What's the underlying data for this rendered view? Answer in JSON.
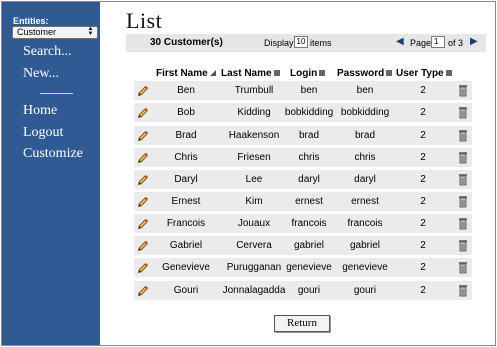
{
  "sidebar": {
    "entities_label": "Entities:",
    "entity_selected": "Customer",
    "links": [
      "Search...",
      "New...",
      "Home",
      "Logout",
      "Customize"
    ]
  },
  "page": {
    "title": "List"
  },
  "infobar": {
    "count_text": "30 Customer(s)",
    "display_label": "Display",
    "display_value": "10",
    "items_label": "items",
    "page_label": "Page",
    "page_value": "1",
    "of_label": "of 3"
  },
  "table": {
    "headers": {
      "first": "First Name",
      "last": "Last Name",
      "login": "Login",
      "password": "Password",
      "type": "User Type"
    },
    "rows": [
      {
        "first": "Ben",
        "last": "Trumbull",
        "login": "ben",
        "password": "ben",
        "type": "2"
      },
      {
        "first": "Bob",
        "last": "Kidding",
        "login": "bobkidding",
        "password": "bobkidding",
        "type": "2"
      },
      {
        "first": "Brad",
        "last": "Haakenson",
        "login": "brad",
        "password": "brad",
        "type": "2"
      },
      {
        "first": "Chris",
        "last": "Friesen",
        "login": "chris",
        "password": "chris",
        "type": "2"
      },
      {
        "first": "Daryl",
        "last": "Lee",
        "login": "daryl",
        "password": "daryl",
        "type": "2"
      },
      {
        "first": "Ernest",
        "last": "Kim",
        "login": "ernest",
        "password": "ernest",
        "type": "2"
      },
      {
        "first": "Francois",
        "last": "Jouaux",
        "login": "francois",
        "password": "francois",
        "type": "2"
      },
      {
        "first": "Gabriel",
        "last": "Cervera",
        "login": "gabriel",
        "password": "gabriel",
        "type": "2"
      },
      {
        "first": "Genevieve",
        "last": "Purugganan",
        "login": "genevieve",
        "password": "genevieve",
        "type": "2"
      },
      {
        "first": "Gouri",
        "last": "Jonnalagadda",
        "login": "gouri",
        "password": "gouri",
        "type": "2"
      }
    ]
  },
  "buttons": {
    "return_label": "Return"
  },
  "colors": {
    "sidebar_bg": "#2f5a93",
    "row_bg": "#ebebeb",
    "infobar_bg": "#e6e6e6"
  },
  "icons": {
    "edit": "pencil-icon",
    "delete": "trash-icon",
    "prev": "prev-arrow-icon",
    "next": "next-arrow-icon"
  }
}
